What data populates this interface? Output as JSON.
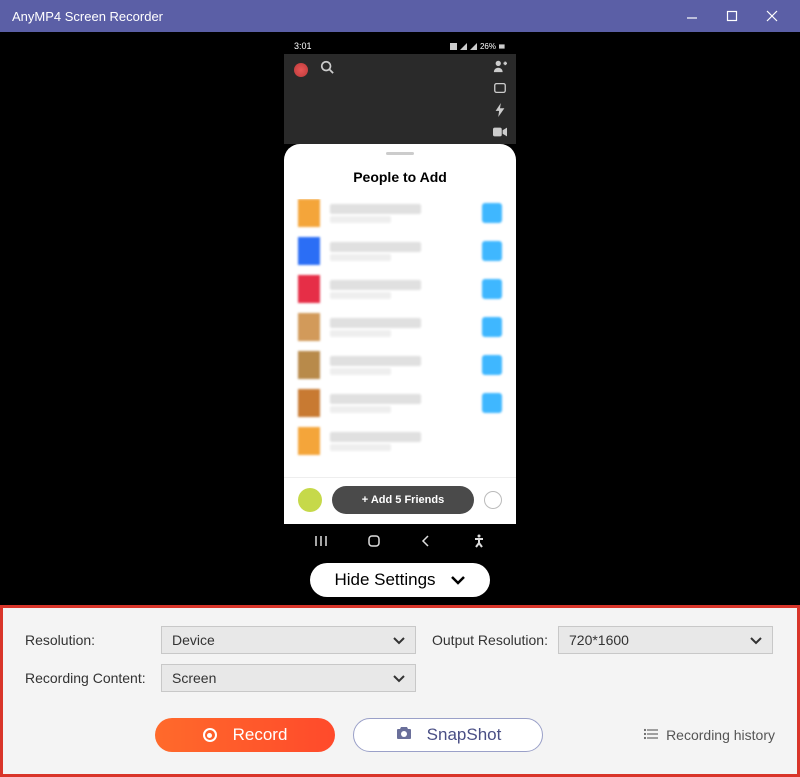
{
  "window": {
    "title": "AnyMP4 Screen Recorder"
  },
  "phone": {
    "status": {
      "time": "3:01",
      "battery": "26%"
    },
    "sheet": {
      "title": "People to Add",
      "add_button": "+ Add 5 Friends"
    },
    "contacts": [
      {
        "avatar_color": "#f4a53a",
        "action_color": "#3fb7ff"
      },
      {
        "avatar_color": "#2b6ef5",
        "action_color": "#3fb7ff"
      },
      {
        "avatar_color": "#e62e47",
        "action_color": "#3fb7ff"
      },
      {
        "avatar_color": "#d29a5a",
        "action_color": "#3fb7ff"
      },
      {
        "avatar_color": "#b88a4a",
        "action_color": "#3fb7ff"
      },
      {
        "avatar_color": "#c87a32",
        "action_color": "#3fb7ff"
      },
      {
        "avatar_color": "#f4a53a",
        "action_color": "#ffffff"
      }
    ]
  },
  "toggle": {
    "label": "Hide Settings"
  },
  "settings": {
    "resolution_label": "Resolution:",
    "resolution_value": "Device",
    "output_label": "Output Resolution:",
    "output_value": "720*1600",
    "content_label": "Recording Content:",
    "content_value": "Screen",
    "record_label": "Record",
    "snapshot_label": "SnapShot",
    "history_label": "Recording history"
  }
}
